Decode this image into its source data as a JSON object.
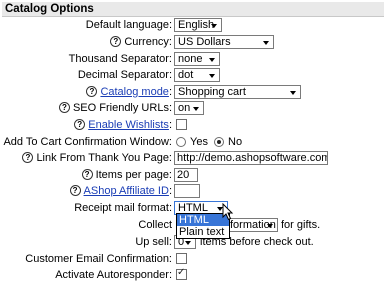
{
  "header": {
    "title": "Catalog Options"
  },
  "fields": {
    "default_language": {
      "label": "Default language:",
      "value": "English"
    },
    "currency": {
      "label": "Currency:",
      "value": "US Dollars"
    },
    "thousand_sep": {
      "label": "Thousand Separator:",
      "value": "none"
    },
    "decimal_sep": {
      "label": "Decimal Separator:",
      "value": "dot"
    },
    "catalog_mode": {
      "label": "Catalog mode",
      "colon": ":",
      "value": "Shopping cart"
    },
    "seo": {
      "label": "SEO Friendly URLs:",
      "value": "on"
    },
    "wishlists": {
      "label": "Enable Wishlists",
      "colon": ":"
    },
    "add_to_cart": {
      "label": "Add To Cart Confirmation Window:",
      "yes": "Yes",
      "no": "No"
    },
    "thank_you": {
      "label": "Link From Thank You Page:",
      "value": "http://demo.ashopsoftware.com"
    },
    "items_per_page": {
      "label": "Items per page:",
      "value": "20"
    },
    "affiliate": {
      "label": "AShop Affiliate ID",
      "colon": ":",
      "value": ""
    },
    "receipt": {
      "label": "Receipt mail format:",
      "value": "HTML",
      "options": [
        "HTML",
        "Plain text"
      ]
    },
    "collect": {
      "label": "Collect",
      "value": "formation",
      "suffix": "for gifts."
    },
    "upsell": {
      "label": "Up sell:",
      "value": "0",
      "suffix": "items before check out."
    },
    "customer_email": {
      "label": "Customer Email Confirmation:"
    },
    "autoresponder": {
      "label": "Activate Autoresponder:"
    }
  }
}
